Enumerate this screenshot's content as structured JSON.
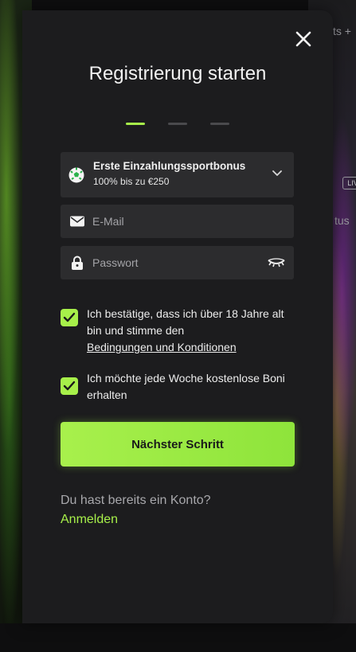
{
  "background": {
    "top_right_text": "ts +",
    "side_text": "tus",
    "live_badge": "LIV"
  },
  "modal": {
    "title": "Registrierung starten",
    "steps": {
      "total": 3,
      "active": 1
    },
    "bonus": {
      "icon": "soccer-ball-icon",
      "title": "Erste Einzahlungssportbonus",
      "subtitle": "100% bis zu €250"
    },
    "email": {
      "placeholder": "E-Mail",
      "icon": "envelope-icon"
    },
    "password": {
      "placeholder": "Passwort",
      "icon": "lock-icon",
      "toggle_icon": "eye-closed-icon"
    },
    "checkbox_age": {
      "checked": true,
      "text": "Ich bestätige, dass ich über 18 Jahre alt bin und stimme den",
      "link": "Bedingungen und Konditionen"
    },
    "checkbox_newsletter": {
      "checked": true,
      "text": "Ich möchte jede Woche kostenlose Boni erhalten"
    },
    "next_button": "Nächster Schritt",
    "have_account": "Du hast bereits ein Konto?",
    "login_link": "Anmelden",
    "colors": {
      "accent": "#a7f04a",
      "panel": "#1c1c1e",
      "field": "#2c2c2e"
    }
  }
}
